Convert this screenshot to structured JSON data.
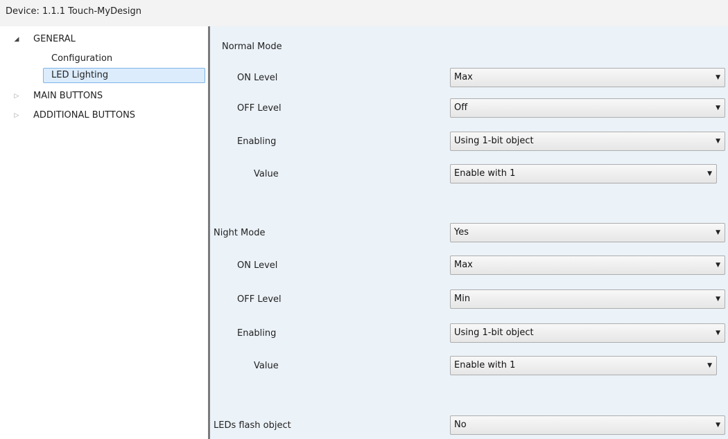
{
  "window": {
    "title": "Device: 1.1.1  Touch-MyDesign"
  },
  "tree": {
    "general": "GENERAL",
    "configuration": "Configuration",
    "led_lighting": "LED Lighting",
    "main_buttons": "MAIN BUTTONS",
    "additional_buttons": "ADDITIONAL BUTTONS"
  },
  "icons": {
    "expanded": "triangle-down-icon",
    "collapsed": "triangle-right-icon",
    "dropdown": "chevron-down-icon"
  },
  "colors": {
    "selection": "#dcecfc",
    "selection_border": "#7eb4ea",
    "panel_bg": "#ebf2f8"
  },
  "panel": {
    "normal_mode": {
      "label": "Normal Mode",
      "on_level": {
        "label": "ON Level",
        "value": "Max"
      },
      "off_level": {
        "label": "OFF Level",
        "value": "Off"
      },
      "enabling": {
        "label": "Enabling",
        "value": "Using 1-bit object"
      },
      "value": {
        "label": "Value",
        "value": "Enable with 1"
      }
    },
    "night_mode": {
      "label": "Night Mode",
      "value": "Yes",
      "on_level": {
        "label": "ON Level",
        "value": "Max"
      },
      "off_level": {
        "label": "OFF Level",
        "value": "Min"
      },
      "enabling": {
        "label": "Enabling",
        "value": "Using 1-bit object"
      },
      "value_field": {
        "label": "Value",
        "value": "Enable with 1"
      }
    },
    "leds_flash": {
      "label": "LEDs flash object",
      "value": "No"
    }
  }
}
